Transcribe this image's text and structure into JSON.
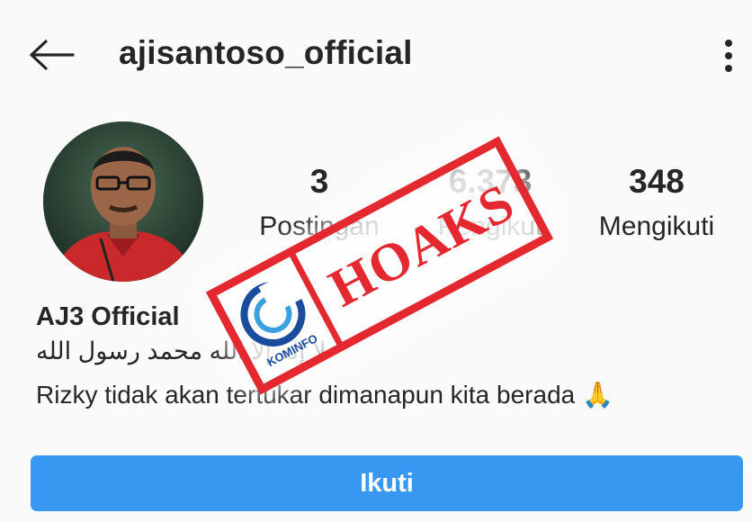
{
  "header": {
    "username": "ajisantoso_official"
  },
  "stats": {
    "posts": {
      "value": "3",
      "label": "Postingan"
    },
    "followers": {
      "value": "6.373",
      "label": "Pengikut"
    },
    "following": {
      "value": "348",
      "label": "Mengikuti"
    }
  },
  "profile": {
    "full_name": "AJ3 Official",
    "bio_arabic": "لا إله إلا الله محمد رسول الله",
    "bio_text": "Rizky tidak akan tertukar dimanapun kita berada 🙏"
  },
  "actions": {
    "follow_label": "Ikuti"
  },
  "overlay": {
    "stamp_text": "HOAKS",
    "stamp_logo_text": "KOMINFO"
  },
  "colors": {
    "accent": "#3897f0",
    "stamp_red": "#e3282f",
    "text": "#262626",
    "background": "#fafafa"
  },
  "icons": {
    "back": "arrow-left-icon",
    "more": "more-vertical-icon"
  }
}
